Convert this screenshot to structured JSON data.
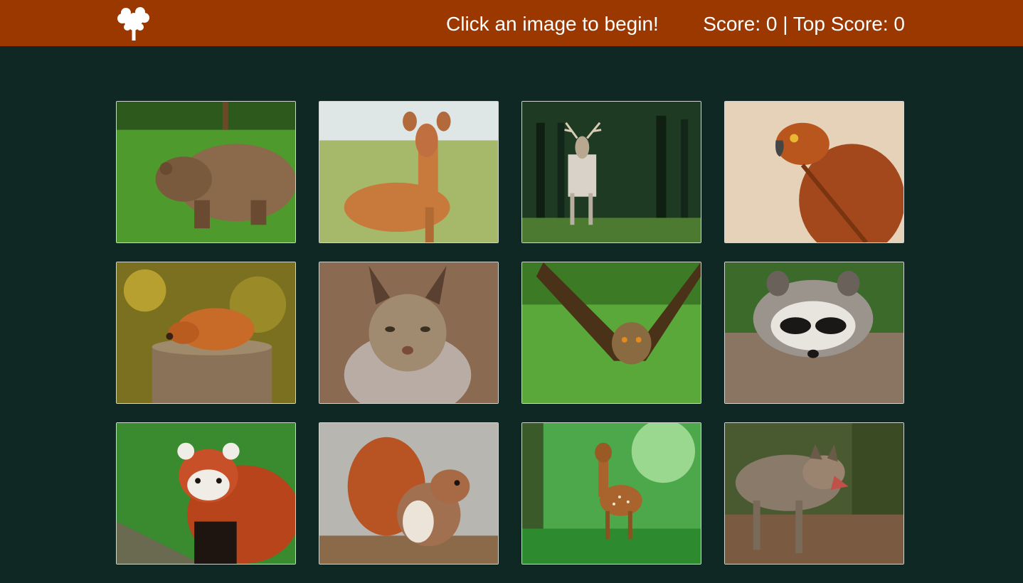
{
  "header": {
    "logo_icon": "tree-icon",
    "message": "Click an image to begin!",
    "score_text": "Score: 0 | Top Score: 0"
  },
  "colors": {
    "navbar": "#9a3800",
    "background": "#102824"
  },
  "cards": [
    {
      "animal": "bear"
    },
    {
      "animal": "deer"
    },
    {
      "animal": "stag"
    },
    {
      "animal": "eagle"
    },
    {
      "animal": "fox"
    },
    {
      "animal": "lynx"
    },
    {
      "animal": "owl"
    },
    {
      "animal": "raccoon"
    },
    {
      "animal": "red-panda"
    },
    {
      "animal": "squirrel"
    },
    {
      "animal": "fawn"
    },
    {
      "animal": "wolf"
    }
  ]
}
